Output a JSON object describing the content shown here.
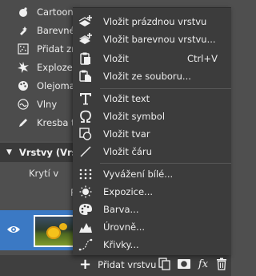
{
  "effects": [
    {
      "label": "Cartoon",
      "icon": "cartoon-icon"
    },
    {
      "label": "Barevné t",
      "icon": "color-tone-icon"
    },
    {
      "label": "Přidat zrn",
      "icon": "grain-icon"
    },
    {
      "label": "Exploze",
      "icon": "explosion-icon"
    },
    {
      "label": "Olejomal",
      "icon": "oil-paint-icon"
    },
    {
      "label": "Vlny",
      "icon": "waves-icon"
    },
    {
      "label": "Kresba tu",
      "icon": "ink-sketch-icon"
    }
  ],
  "layers": {
    "header": "Vrstvy (Vrs",
    "opacity_label": "Krytí v",
    "blend_label": "R",
    "layer_name": "V"
  },
  "menu": {
    "items": [
      {
        "label": "Vložit prázdnou vrstvu",
        "shortcut": "",
        "icon": "add-empty-layer-icon"
      },
      {
        "label": "Vložit barevnou vrstvu...",
        "shortcut": "",
        "icon": "add-color-layer-icon"
      },
      {
        "label": "Vložit",
        "shortcut": "Ctrl+V",
        "icon": "paste-icon"
      },
      {
        "label": "Vložit ze souboru...",
        "shortcut": "",
        "icon": "paste-from-file-icon"
      },
      {
        "label": "Vložit text",
        "shortcut": "",
        "icon": "text-icon"
      },
      {
        "label": "Vložit symbol",
        "shortcut": "",
        "icon": "symbol-omega-icon"
      },
      {
        "label": "Vložit tvar",
        "shortcut": "",
        "icon": "shape-icon"
      },
      {
        "label": "Vložit čáru",
        "shortcut": "",
        "icon": "line-icon"
      },
      {
        "label": "Vyvážení bílé...",
        "shortcut": "",
        "icon": "white-balance-icon"
      },
      {
        "label": "Expozice...",
        "shortcut": "",
        "icon": "exposure-icon"
      },
      {
        "label": "Barva...",
        "shortcut": "",
        "icon": "palette-icon"
      },
      {
        "label": "Úrovně...",
        "shortcut": "",
        "icon": "levels-icon"
      },
      {
        "label": "Křivky...",
        "shortcut": "",
        "icon": "curves-icon"
      }
    ]
  },
  "bottom_bar": {
    "add_layer_label": "Přidat vrstvu",
    "tools": [
      "duplicate-icon",
      "mask-icon",
      "fx-icon",
      "trash-icon"
    ],
    "fx_label": "fx"
  },
  "colors": {
    "menu_bg": "#3c3c3c",
    "panel_bg": "#4f4f4f",
    "selection": "#3b79c4"
  }
}
